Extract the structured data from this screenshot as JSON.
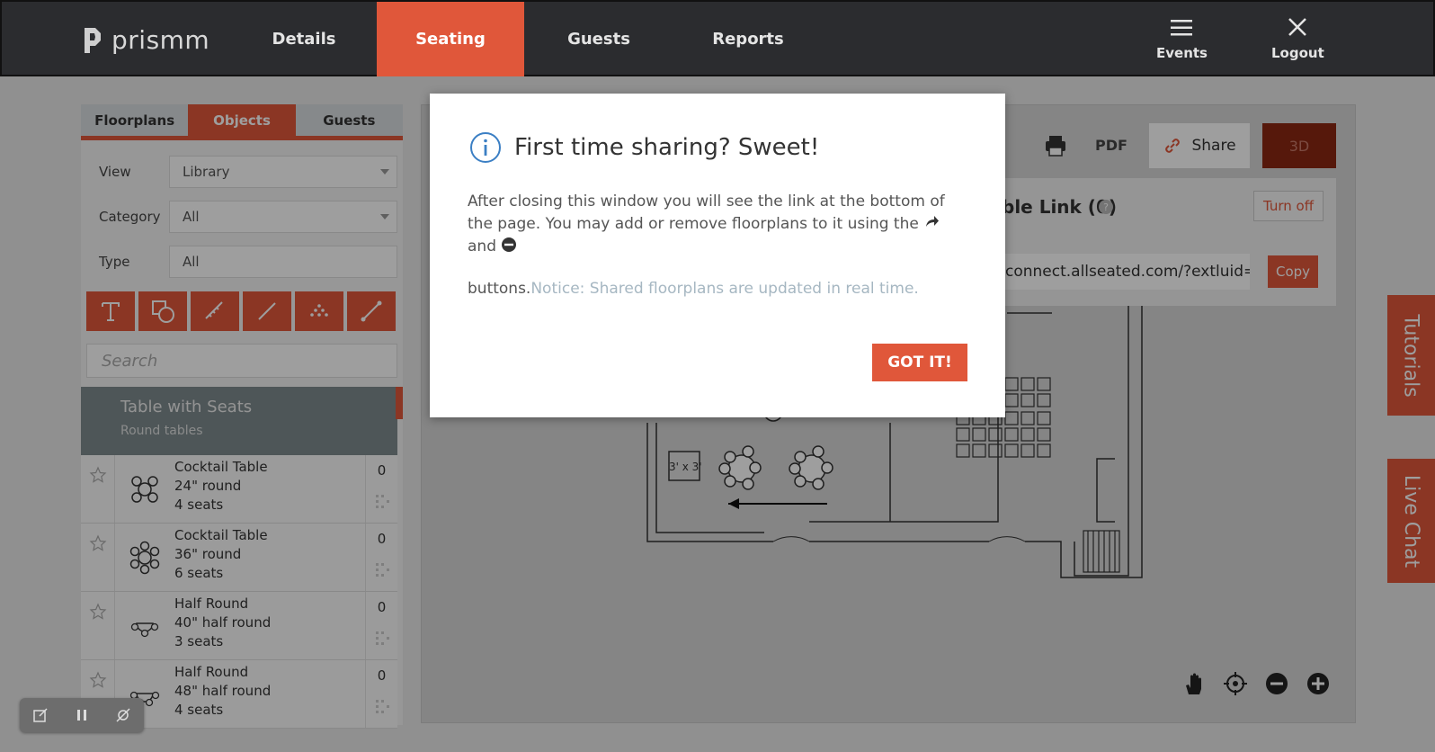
{
  "brand": {
    "name": "prismm"
  },
  "nav": {
    "items": [
      {
        "label": "Details",
        "active": false
      },
      {
        "label": "Seating",
        "active": true
      },
      {
        "label": "Guests",
        "active": false
      },
      {
        "label": "Reports",
        "active": false
      }
    ],
    "events_label": "Events",
    "logout_label": "Logout"
  },
  "left_panel": {
    "tabs": [
      {
        "label": "Floorplans",
        "active": false
      },
      {
        "label": "Objects",
        "active": true
      },
      {
        "label": "Guests",
        "active": false
      }
    ],
    "view": {
      "label": "View",
      "value": "Library"
    },
    "category": {
      "label": "Category",
      "value": "All"
    },
    "type": {
      "label": "Type",
      "value": "All"
    },
    "tools": [
      "text-tool-icon",
      "shape-tool-icon",
      "measure-tool-icon",
      "line-tool-icon",
      "seating-rows-tool-icon",
      "wall-tool-icon"
    ],
    "search_placeholder": "Search",
    "library_header": {
      "title": "Table with Seats",
      "subtitle": "Round tables"
    },
    "items": [
      {
        "name": "Cocktail Table",
        "size": "24\" round",
        "seats": "4 seats",
        "count": "0"
      },
      {
        "name": "Cocktail Table",
        "size": "36\" round",
        "seats": "6 seats",
        "count": "0"
      },
      {
        "name": "Half Round",
        "size": "40\" half round",
        "seats": "3 seats",
        "count": "0"
      },
      {
        "name": "Half Round",
        "size": "48\" half round",
        "seats": "4 seats",
        "count": "0"
      }
    ]
  },
  "canvas_toolbar": {
    "pdf_label": "PDF",
    "share_label": "Share",
    "three_d_label": "3D"
  },
  "share_panel": {
    "title": "ble Link (0)",
    "turn_off_label": "Turn off",
    "url": "connect.allseated.com/?extluid=",
    "copy_label": "Copy"
  },
  "floorplan": {
    "table_label": "3' x 3'"
  },
  "side_tabs": {
    "tutorials": "Tutorials",
    "live_chat": "Live Chat"
  },
  "modal": {
    "title": "First time sharing? Sweet!",
    "body_part1": "After closing this window you will see the link at the bottom of the page. You may add or remove floorplans to it using the",
    "body_and": "and",
    "body_part2": "buttons.",
    "notice": "Notice: Shared floorplans are updated in real time.",
    "button_label": "GOT IT!"
  },
  "colors": {
    "accent": "#e0573a",
    "topbar": "#2b2c2f",
    "info_blue": "#3b7fc4",
    "notice": "#a6b7c2"
  }
}
